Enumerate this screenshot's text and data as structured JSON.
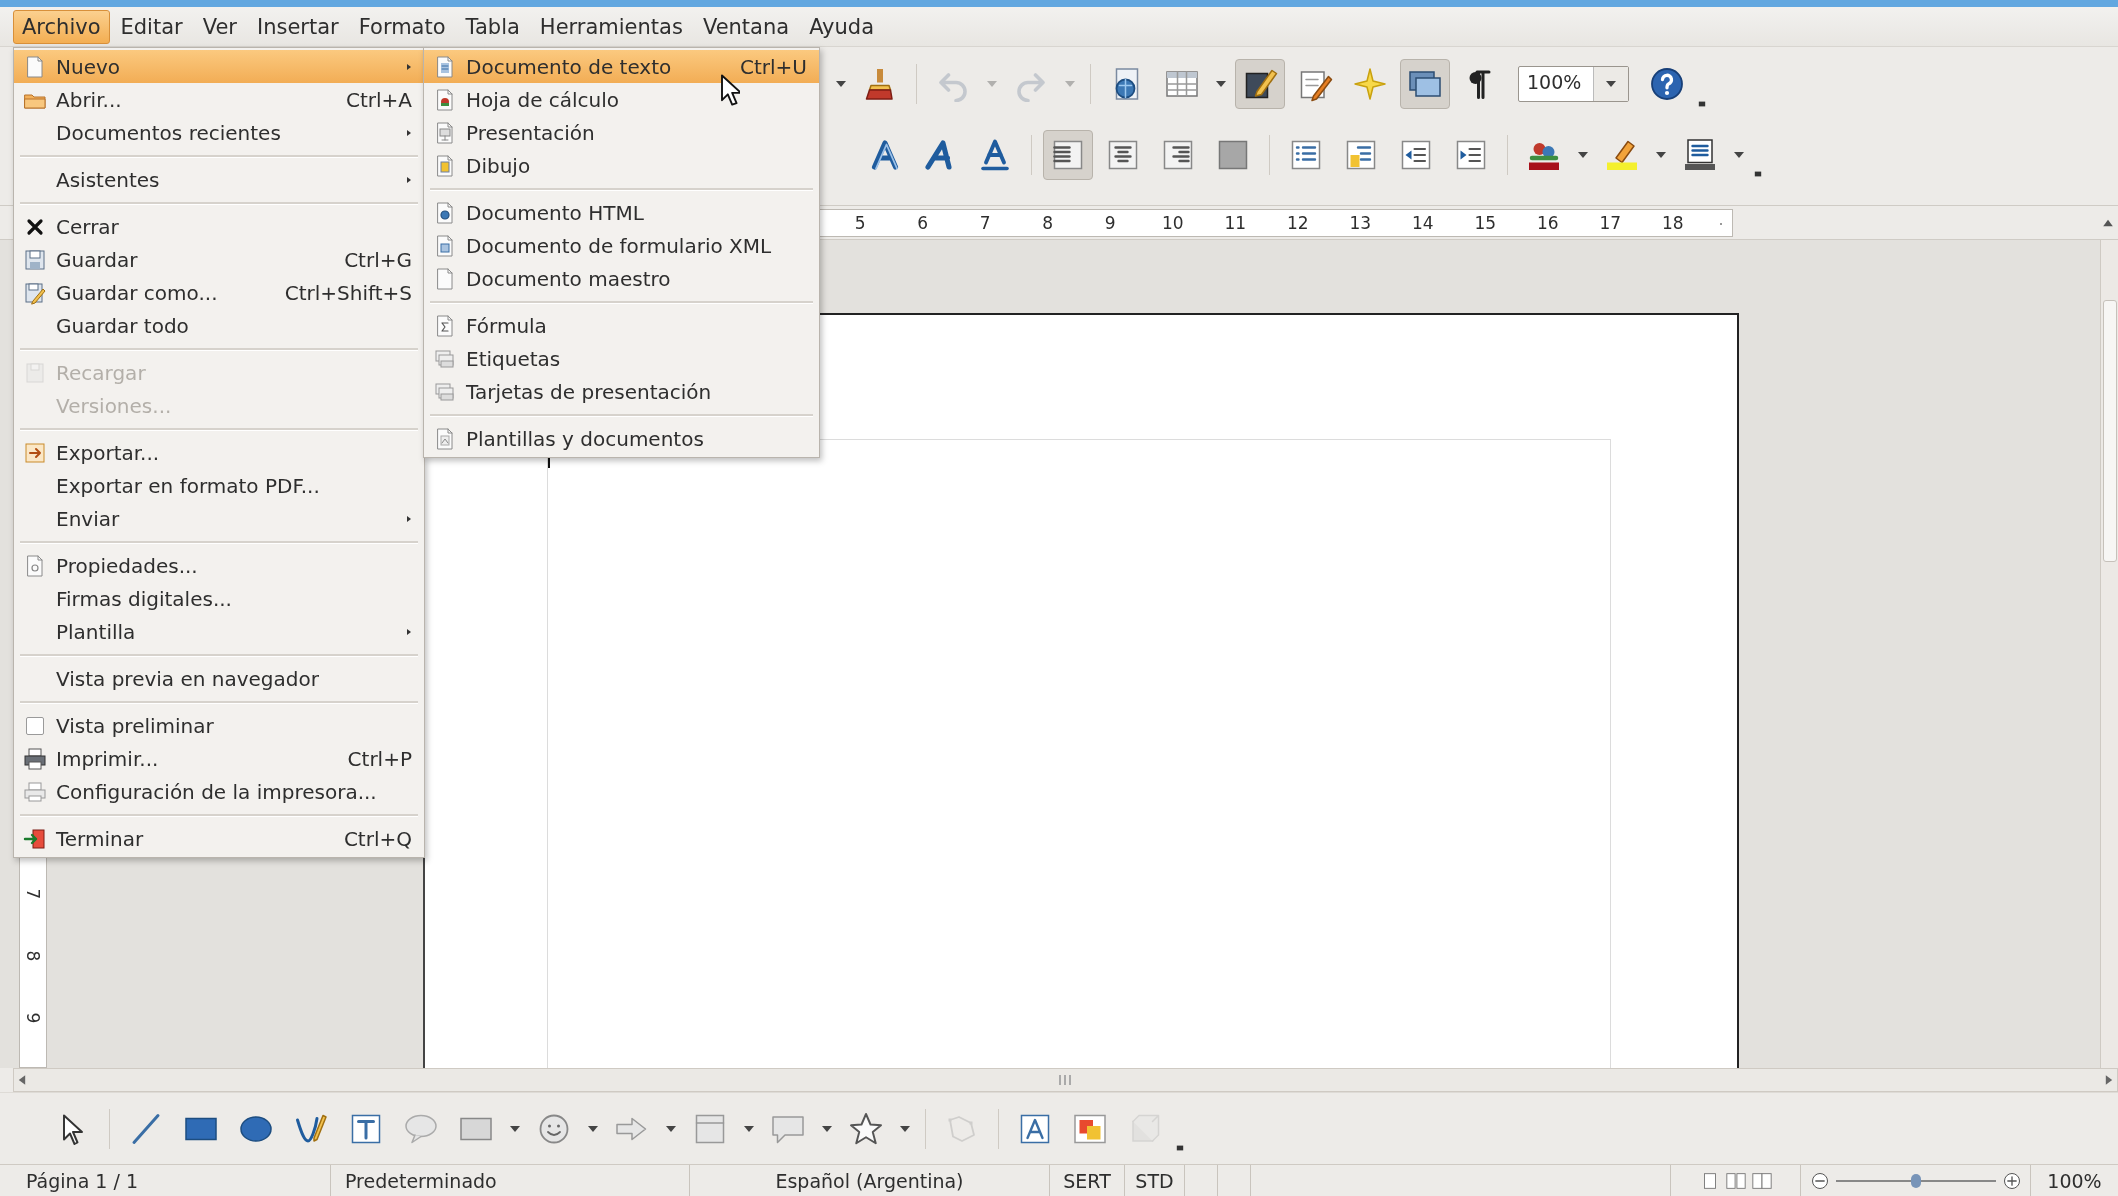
{
  "menubar": [
    {
      "label": "Archivo",
      "selected": true
    },
    {
      "label": "Editar",
      "selected": false
    },
    {
      "label": "Ver",
      "selected": false
    },
    {
      "label": "Insertar",
      "selected": false
    },
    {
      "label": "Formato",
      "selected": false
    },
    {
      "label": "Tabla",
      "selected": false
    },
    {
      "label": "Herramientas",
      "selected": false
    },
    {
      "label": "Ventana",
      "selected": false
    },
    {
      "label": "Ayuda",
      "selected": false
    }
  ],
  "file_menu": [
    {
      "kind": "item",
      "label": "Nuevo",
      "submenu": true,
      "selected": true,
      "disabled": false
    },
    {
      "kind": "item",
      "label": "Abrir...",
      "shortcut": "Ctrl+A",
      "submenu": false,
      "selected": false,
      "disabled": false
    },
    {
      "kind": "item",
      "label": "Documentos recientes",
      "submenu": true,
      "selected": false,
      "disabled": false
    },
    {
      "kind": "separator"
    },
    {
      "kind": "item",
      "label": "Asistentes",
      "submenu": true,
      "selected": false,
      "disabled": false
    },
    {
      "kind": "separator"
    },
    {
      "kind": "item",
      "label": "Cerrar",
      "submenu": false,
      "selected": false,
      "disabled": false
    },
    {
      "kind": "item",
      "label": "Guardar",
      "shortcut": "Ctrl+G",
      "submenu": false,
      "selected": false,
      "disabled": false
    },
    {
      "kind": "item",
      "label": "Guardar como...",
      "shortcut": "Ctrl+Shift+S",
      "submenu": false,
      "selected": false,
      "disabled": false
    },
    {
      "kind": "item",
      "label": "Guardar todo",
      "submenu": false,
      "selected": false,
      "disabled": false
    },
    {
      "kind": "separator"
    },
    {
      "kind": "item",
      "label": "Recargar",
      "submenu": false,
      "selected": false,
      "disabled": true
    },
    {
      "kind": "item",
      "label": "Versiones...",
      "submenu": false,
      "selected": false,
      "disabled": true
    },
    {
      "kind": "separator"
    },
    {
      "kind": "item",
      "label": "Exportar...",
      "submenu": false,
      "selected": false,
      "disabled": false
    },
    {
      "kind": "item",
      "label": "Exportar en formato PDF...",
      "submenu": false,
      "selected": false,
      "disabled": false
    },
    {
      "kind": "item",
      "label": "Enviar",
      "submenu": true,
      "selected": false,
      "disabled": false
    },
    {
      "kind": "separator"
    },
    {
      "kind": "item",
      "label": "Propiedades...",
      "submenu": false,
      "selected": false,
      "disabled": false
    },
    {
      "kind": "item",
      "label": "Firmas digitales...",
      "submenu": false,
      "selected": false,
      "disabled": false
    },
    {
      "kind": "item",
      "label": "Plantilla",
      "submenu": true,
      "selected": false,
      "disabled": false
    },
    {
      "kind": "separator"
    },
    {
      "kind": "item",
      "label": "Vista previa en navegador",
      "submenu": false,
      "selected": false,
      "disabled": false
    },
    {
      "kind": "separator"
    },
    {
      "kind": "check",
      "label": "Vista preliminar",
      "checked": false,
      "submenu": false,
      "selected": false,
      "disabled": false
    },
    {
      "kind": "item",
      "label": "Imprimir...",
      "shortcut": "Ctrl+P",
      "submenu": false,
      "selected": false,
      "disabled": false
    },
    {
      "kind": "item",
      "label": "Configuración de la impresora...",
      "submenu": false,
      "selected": false,
      "disabled": false
    },
    {
      "kind": "separator"
    },
    {
      "kind": "item",
      "label": "Terminar",
      "shortcut": "Ctrl+Q",
      "submenu": false,
      "selected": false,
      "disabled": false
    }
  ],
  "new_submenu": [
    {
      "kind": "item",
      "label": "Documento de texto",
      "shortcut": "Ctrl+U",
      "selected": true
    },
    {
      "kind": "item",
      "label": "Hoja de cálculo",
      "selected": false
    },
    {
      "kind": "item",
      "label": "Presentación",
      "selected": false
    },
    {
      "kind": "item",
      "label": "Dibujo",
      "selected": false
    },
    {
      "kind": "separator"
    },
    {
      "kind": "item",
      "label": "Documento HTML",
      "selected": false
    },
    {
      "kind": "item",
      "label": "Documento de formulario XML",
      "selected": false
    },
    {
      "kind": "item",
      "label": "Documento maestro",
      "selected": false
    },
    {
      "kind": "separator"
    },
    {
      "kind": "item",
      "label": "Fórmula",
      "selected": false
    },
    {
      "kind": "item",
      "label": "Etiquetas",
      "selected": false
    },
    {
      "kind": "item",
      "label": "Tarjetas de presentación",
      "selected": false
    },
    {
      "kind": "separator"
    },
    {
      "kind": "item",
      "label": "Plantillas y documentos",
      "selected": false
    }
  ],
  "standard_toolbar": {
    "buttons": [
      {
        "pressed": false,
        "disabled": false
      },
      {
        "pressed": false,
        "disabled": true
      },
      {
        "pressed": false,
        "disabled": true
      },
      {
        "pressed": false,
        "disabled": false
      },
      {
        "pressed": false,
        "disabled": false
      },
      {
        "pressed": true,
        "disabled": false
      },
      {
        "pressed": false,
        "disabled": false
      },
      {
        "pressed": false,
        "disabled": false
      },
      {
        "pressed": true,
        "disabled": false
      },
      {
        "pressed": false,
        "disabled": false
      },
      {
        "pressed": false,
        "disabled": false
      }
    ],
    "zoom": "100%"
  },
  "formatting_toolbar": {
    "buttons": [
      {
        "pressed": false
      },
      {
        "pressed": false
      },
      {
        "pressed": false
      },
      {
        "pressed": true
      },
      {
        "pressed": false
      },
      {
        "pressed": false
      },
      {
        "pressed": false
      },
      {
        "pressed": false
      },
      {
        "pressed": false
      },
      {
        "pressed": false
      },
      {
        "pressed": false
      },
      {
        "pressed": false
      },
      {
        "pressed": false
      },
      {
        "pressed": false
      }
    ]
  },
  "ruler": {
    "numbers": [
      "5",
      "6",
      "7",
      "8",
      "9",
      "10",
      "11",
      "12",
      "13",
      "14",
      "15",
      "16",
      "17",
      "18"
    ]
  },
  "vertical_ruler": {
    "numbers": [
      "7",
      "8",
      "9"
    ]
  },
  "drawing_toolbar": {
    "buttons": [
      {
        "disabled": false
      },
      {
        "disabled": false
      },
      {
        "disabled": false
      },
      {
        "disabled": false
      },
      {
        "disabled": false
      },
      {
        "disabled": false
      },
      {
        "disabled": false
      },
      {
        "disabled": false
      },
      {
        "disabled": false
      },
      {
        "disabled": false
      },
      {
        "disabled": false
      },
      {
        "disabled": false
      },
      {
        "disabled": false
      },
      {
        "disabled": true
      },
      {
        "disabled": false
      },
      {
        "disabled": false
      },
      {
        "disabled": true
      }
    ]
  },
  "status_bar": {
    "page": "Página 1 / 1",
    "style": "Predeterminado",
    "language": "Español (Argentina)",
    "insert_mode": "SERT",
    "selection_mode": "STD",
    "zoom": {
      "level": 0.5,
      "value": "100%"
    }
  }
}
